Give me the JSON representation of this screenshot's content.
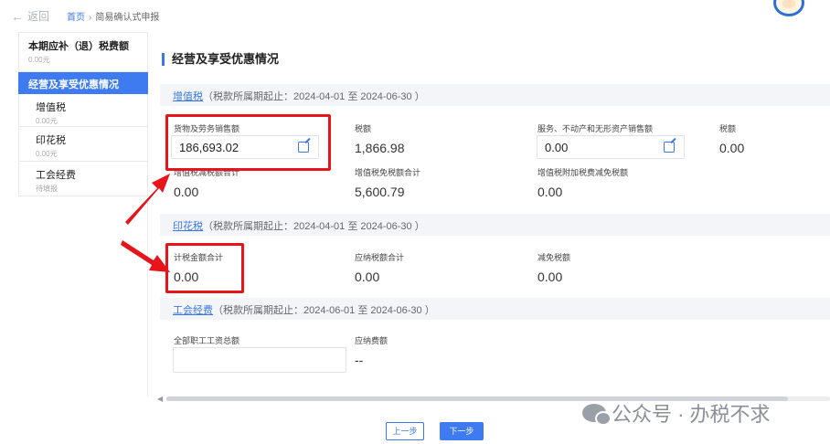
{
  "topbar": {
    "back_label": "返回",
    "breadcrumb": {
      "home": "首页",
      "separator": "›",
      "current": "简易确认式申报"
    }
  },
  "sidebar": {
    "items": [
      {
        "title": "本期应补（退）税费额",
        "sub": "0.00元"
      },
      {
        "title": "经营及享受优惠情况",
        "sub": ""
      },
      {
        "title": "增值税",
        "sub": "0.00元"
      },
      {
        "title": "印花税",
        "sub": "0.00元"
      },
      {
        "title": "工会经费",
        "sub": "待填报"
      }
    ]
  },
  "main": {
    "section_title": "经营及享受优惠情况",
    "vat": {
      "link": "增值税",
      "period": "（税款所属期起止：2024-04-01 至 2024-06-30 ）",
      "goods_sales_label": "货物及劳务销售额",
      "goods_sales_value": "186,693.02",
      "tax_label": "税额",
      "tax_value": "1,866.98",
      "services_sales_label": "服务、不动产和无形资产销售额",
      "services_sales_value": "0.00",
      "tax2_label": "税额",
      "tax2_value": "0.00",
      "reduction_total_label": "增值税减税额合计",
      "reduction_total_value": "0.00",
      "exempt_total_label": "增值税免税额合计",
      "exempt_total_value": "5,600.79",
      "surcharge_reduction_label": "增值税附加税费减免税额",
      "surcharge_reduction_value": "0.00"
    },
    "stamp": {
      "link": "印花税",
      "period": "（税款所属期起止：2024-04-01 至 2024-06-30 ）",
      "taxable_amount_label": "计税金额合计",
      "taxable_amount_value": "0.00",
      "payable_label": "应纳税额合计",
      "payable_value": "0.00",
      "exempt_label": "减免税额",
      "exempt_value": "0.00"
    },
    "union": {
      "link": "工会经费",
      "period": "（税款所属期起止：2024-06-01 至 2024-06-30 ）",
      "wages_label": "全部职工工资总额",
      "wages_value": "",
      "fee_label": "应纳费额",
      "fee_value": "--"
    }
  },
  "footer": {
    "prev_label": "上一步",
    "next_label": "下一步"
  },
  "watermark": {
    "text": "公众号 · 办税不求"
  },
  "colors": {
    "accent": "#3e7bf0",
    "highlight": "#e8141b"
  }
}
